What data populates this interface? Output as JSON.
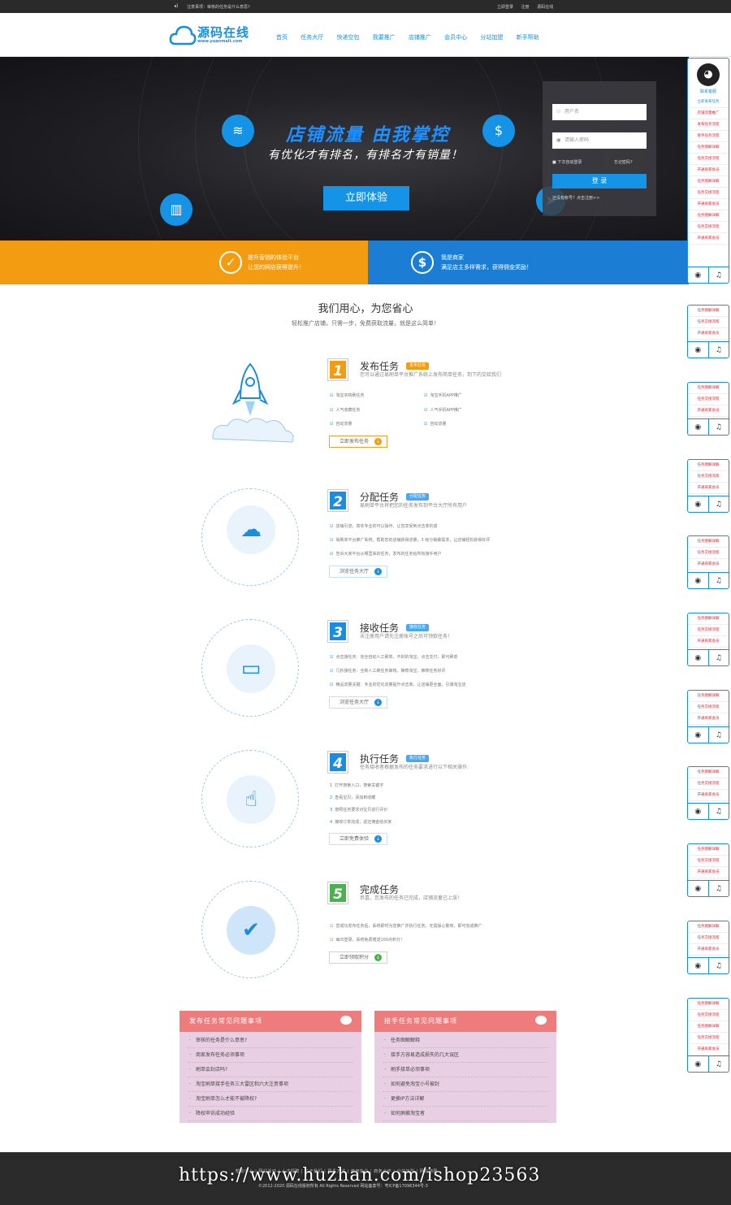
{
  "topbar": {
    "notice": "注意事项：审核的任务是什么意思?",
    "links": [
      "立即登录",
      "注册",
      "源码在线"
    ]
  },
  "logo": {
    "name": "源码在线",
    "url": "www.yuanmalt.com"
  },
  "nav": [
    "首页",
    "任务大厅",
    "快递空包",
    "我要推广",
    "店铺推广",
    "会员中心",
    "分站加盟",
    "新手帮助"
  ],
  "banner": {
    "title": "店铺流量  由我掌控",
    "subtitle": "有优化才有排名，有排名才有销量！",
    "cta": "立即体验"
  },
  "login": {
    "username_placeholder": "用户名",
    "password_placeholder": "请输入密码",
    "remember": "下次自动登录",
    "forgot": "忘记密码?",
    "submit": "登 录",
    "register": "还没有帐号？点击注册>>"
  },
  "strips": [
    {
      "line1": "提升营销的体验平台",
      "line2": "让您的网店获得提升！"
    },
    {
      "line1": "我是商家",
      "line2": "满足店主多样需求，获得佣金奖励！"
    }
  ],
  "section": {
    "title": "我们用心，为您省心",
    "subtitle": "轻松推广店铺，只需一步，免费获取流量，就是这么简单！"
  },
  "steps": [
    {
      "num": "1",
      "title": "发布任务",
      "badge": "发布任务",
      "color": "#f39c12",
      "desc": "您可以通过易刷单平台推广系统上发布简单任务，到下的交给我们",
      "items": [
        "淘宝实物刷任务",
        "淘宝手机APP推广",
        "人气收藏任务",
        "人气手机APP推广",
        "自动流量",
        "自动流量"
      ],
      "button": "立即发布任务"
    },
    {
      "num": "2",
      "title": "分配任务",
      "badge": "分配任务",
      "color": "#1a8de0",
      "desc": "易刷单平台将把您的任务发布到平台大厅所有用户",
      "items": [
        "店铺引流，真实专业的可以操作，让您享受到点击率的成",
        "易刷单平台推广系统，帮助您的店铺获得流量，3 级分销做需求，让店铺轻松获得好评",
        "告诉大家平台从哪里来的任务，发布的任务给所有接手用户"
      ],
      "button": "浏览任务大厅"
    },
    {
      "num": "3",
      "title": "接收任务",
      "badge": "接收任务",
      "color": "#1a8de0",
      "desc": "未注册用户请先注册账号之后可领取任务！",
      "items": [
        "点击接任务：完全自动人工刷单，不封的淘宝，点击支付，即可刷单",
        "几秒接任务：全新人工刷任务审核，推荐淘宝，推荐任务好评",
        "精品流量关键：专业的优化流量提升点击率，让店铺更全面，引爆淘宝店"
      ],
      "button": "浏览任务大厅"
    },
    {
      "num": "4",
      "title": "执行任务",
      "badge": "执行任务",
      "color": "#1a8de0",
      "desc": "任务接收者根据发布的任务要求进行以下相关操作:",
      "items": [
        "打开搜索入口，搜索关键字",
        "查看宝贝，添加到收藏",
        "按照任务要求对宝贝进行评价",
        "接收订单完成，返还佣金给买家"
      ],
      "button": "立即免费体验"
    },
    {
      "num": "5",
      "title": "完成任务",
      "badge": "",
      "color": "#4cb050",
      "desc": "恭喜，您发布的任务已完成，店铺流量已上涨！",
      "items": [
        "您成功发布任务后，系统即时为您推广并执行任务，无需操心繁琐，即可完成推广",
        "每日登录，系统免费赠送100点积分！"
      ],
      "button": "立即领取积分"
    }
  ],
  "faq_left": {
    "title": "发布任务常见问题事项",
    "items": [
      "审核的任务是什么意思?",
      "商家发布任务必须事项",
      "刷单会封店吗?",
      "淘宝刷单接手任务三大雷区和六大注意事项",
      "淘宝刷单怎么才能不被降权?",
      "降权申诉成功经验"
    ]
  },
  "faq_right": {
    "title": "接手任务常见问题事项",
    "items": [
      "任务图解解释",
      "接手方容易造成损失的几大误区",
      "刷手接单必须事项",
      "如何避免淘宝小号被封",
      "更换IP方法详解",
      "如何屏蔽淘宝者"
    ]
  },
  "footer": {
    "links": "帮助中心 | 网站活动 | 人才招聘 | 关于我们 | 联系方式 | 使用协议 | 商务合作 | 分站加盟 | 网站地图",
    "copyright": "©2012-2020 源码在线版权所有 All Rights Reserved 网站备案号：粤ICP备17096344号-3"
  },
  "watermark": "https://www.huzhan.com/ishop23563",
  "side": {
    "qq_label": "联系客服",
    "first_links": [
      "立即发布任务",
      "店铺流量推广",
      "发布任务流程",
      "接手任务流程",
      "任务图解详解",
      "任务交接流程",
      "开通商家会员"
    ],
    "repeat_links": [
      "任务图解详解",
      "任务交接流程",
      "开通商家会员"
    ]
  }
}
